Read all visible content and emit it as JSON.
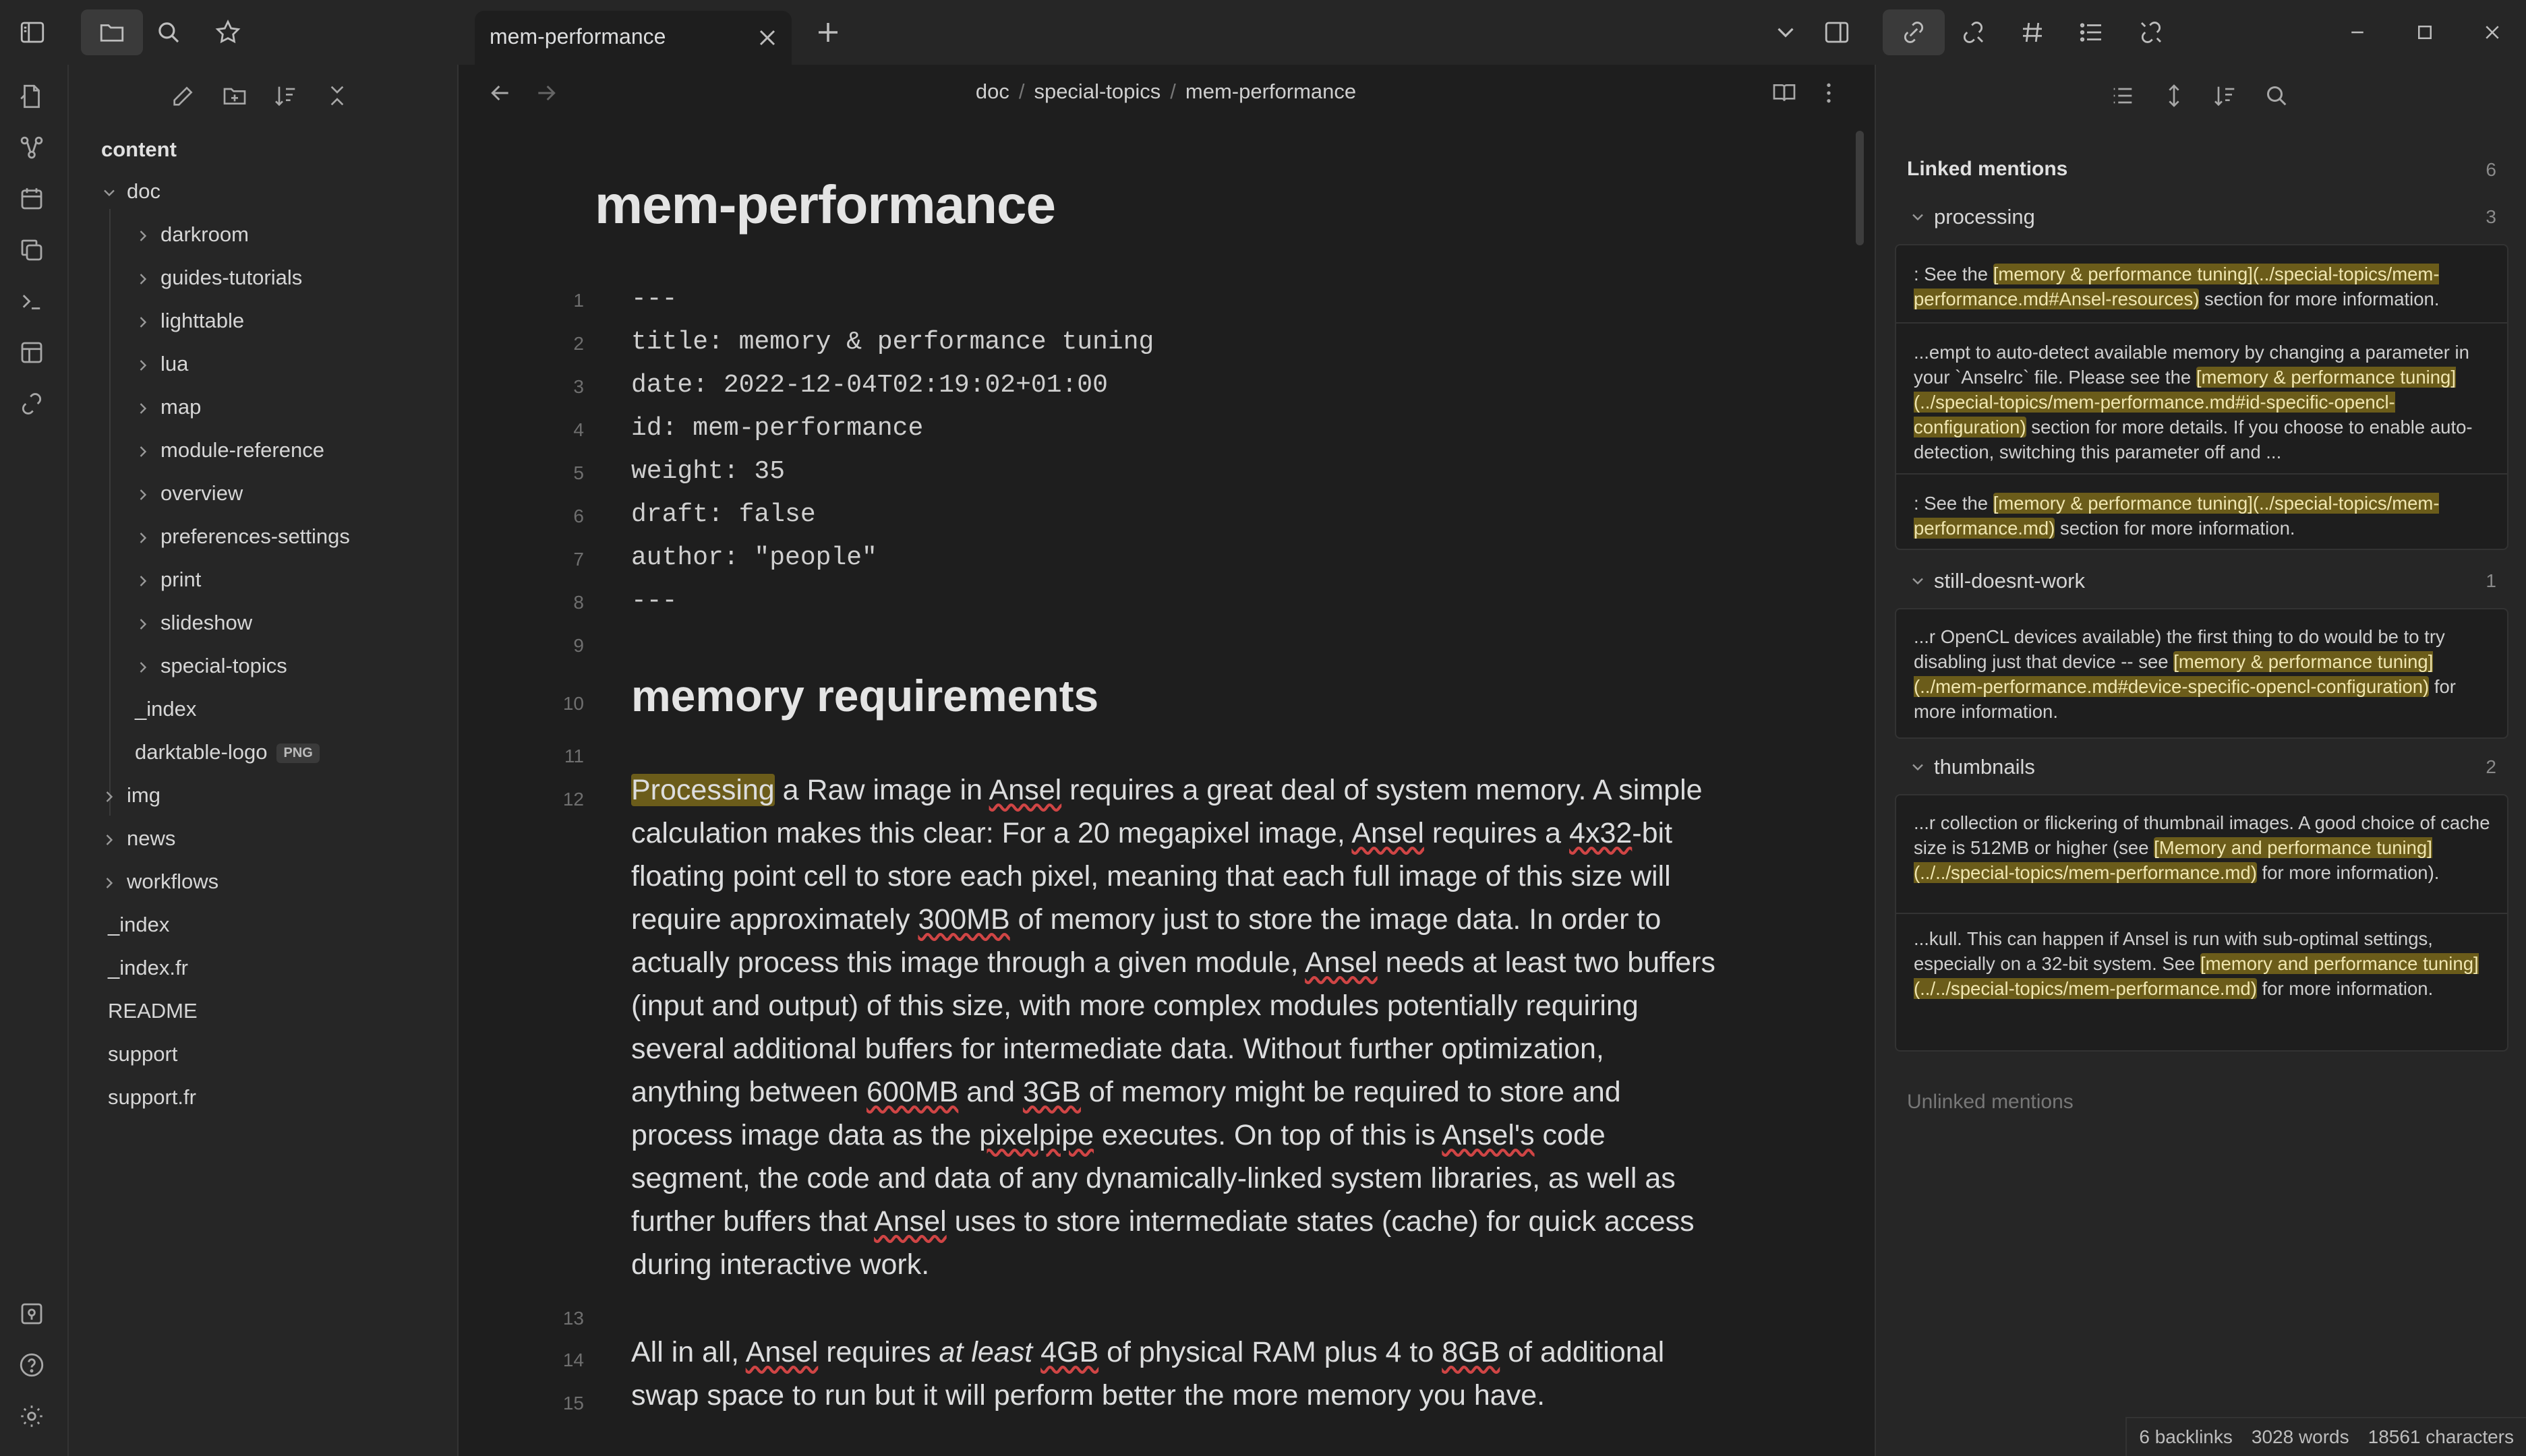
{
  "tab": {
    "title": "mem-performance"
  },
  "explorer": {
    "root": "content",
    "doc": "doc",
    "doc_children": [
      "darkroom",
      "guides-tutorials",
      "lighttable",
      "lua",
      "map",
      "module-reference",
      "overview",
      "preferences-settings",
      "print",
      "slideshow",
      "special-topics"
    ],
    "doc_files": [
      "_index",
      "darktable-logo"
    ],
    "logo_tag": "PNG",
    "root_folders": [
      "img",
      "news",
      "workflows"
    ],
    "root_files": [
      "_index",
      "_index.fr",
      "README",
      "support",
      "support.fr"
    ]
  },
  "breadcrumb": [
    "doc",
    "special-topics",
    "mem-performance"
  ],
  "breadcrumb_sep": "/",
  "editor": {
    "title": "mem-performance",
    "frontmatter": [
      "---",
      "title: memory & performance tuning",
      "date: 2022-12-04T02:19:02+01:00",
      "id: mem-performance",
      "weight: 35",
      "draft: false",
      "author: \"people\"",
      "---"
    ],
    "heading": "memory requirements",
    "line_numbers": [
      "1",
      "2",
      "3",
      "4",
      "5",
      "6",
      "7",
      "8",
      "9",
      "10",
      "11",
      "12",
      "13",
      "14",
      "15"
    ],
    "p1": [
      {
        "t": "Processing",
        "c": "hl"
      },
      {
        "t": " a Raw image in ",
        "c": ""
      },
      {
        "t": "Ansel",
        "c": "ul"
      },
      {
        "t": " requires a great deal of system memory. A simple calculation makes this clear: For a 20 megapixel image, ",
        "c": ""
      },
      {
        "t": "Ansel",
        "c": "ul"
      },
      {
        "t": " requires a ",
        "c": ""
      },
      {
        "t": "4x32",
        "c": "ul"
      },
      {
        "t": "-bit floating point cell to store each pixel, meaning that each full image of this size will require approximately ",
        "c": ""
      },
      {
        "t": "300MB",
        "c": "ul"
      },
      {
        "t": " of memory just to store the image data. In order to actually process this image through a given module, ",
        "c": ""
      },
      {
        "t": "Ansel",
        "c": "ul"
      },
      {
        "t": " needs at least two buffers (input and output) of this size, with more complex modules potentially requiring several additional buffers for intermediate data. Without further optimization, anything between ",
        "c": ""
      },
      {
        "t": "600MB",
        "c": "ul"
      },
      {
        "t": " and ",
        "c": ""
      },
      {
        "t": "3GB",
        "c": "ul"
      },
      {
        "t": " of memory might be required to store and process image data as the ",
        "c": ""
      },
      {
        "t": "pixelpipe",
        "c": "ul"
      },
      {
        "t": " executes. On top of this is ",
        "c": ""
      },
      {
        "t": "Ansel's",
        "c": "ul"
      },
      {
        "t": " code segment, the code and data of any dynamically-linked system libraries, as well as further buffers that ",
        "c": ""
      },
      {
        "t": "Ansel",
        "c": "ul"
      },
      {
        "t": " uses to store intermediate states (cache) for quick access during interactive work.",
        "c": ""
      }
    ],
    "p2": [
      {
        "t": "All in all, ",
        "c": ""
      },
      {
        "t": "Ansel",
        "c": "ul"
      },
      {
        "t": " requires ",
        "c": ""
      },
      {
        "t": "at least",
        "c": "em"
      },
      {
        "t": " ",
        "c": ""
      },
      {
        "t": "4GB",
        "c": "ul"
      },
      {
        "t": " of physical RAM plus 4 to ",
        "c": ""
      },
      {
        "t": "8GB",
        "c": "ul"
      },
      {
        "t": " of additional swap space to run but it will perform better the more memory you have.",
        "c": ""
      }
    ]
  },
  "backlinks": {
    "linked_title": "Linked mentions",
    "linked_count": "6",
    "groups": [
      {
        "name": "processing",
        "count": "3",
        "snippets": [
          [
            {
              "t": ": See the ",
              "c": ""
            },
            {
              "t": "[memory & performance tuning](../special-topics/mem-performance.md#Ansel-resources)",
              "c": "hl"
            },
            {
              "t": " section for more information.",
              "c": ""
            }
          ],
          [
            {
              "t": "...empt to auto-detect available memory by changing a parameter in your `Anselrc` file. Please see the ",
              "c": ""
            },
            {
              "t": "[memory & performance tuning](../special-topics/mem-performance.md#id-specific-opencl-configuration)",
              "c": "hl"
            },
            {
              "t": " section for more details. If you choose to enable auto-detection, switching this parameter off and ...",
              "c": ""
            }
          ],
          [
            {
              "t": ": See the ",
              "c": ""
            },
            {
              "t": "[memory & performance tuning](../special-topics/mem-performance.md)",
              "c": "hl"
            },
            {
              "t": " section for more information.",
              "c": ""
            }
          ]
        ]
      },
      {
        "name": "still-doesnt-work",
        "count": "1",
        "snippets": [
          [
            {
              "t": "...r OpenCL devices available) the first thing to do would be to try disabling just that device -- see ",
              "c": ""
            },
            {
              "t": "[memory & performance tuning](../mem-performance.md#device-specific-opencl-configuration)",
              "c": "hl"
            },
            {
              "t": " for more information.",
              "c": ""
            }
          ]
        ]
      },
      {
        "name": "thumbnails",
        "count": "2",
        "snippets": [
          [
            {
              "t": "...r collection or flickering of thumbnail images. A good choice of cache size is 512MB or higher (see ",
              "c": ""
            },
            {
              "t": "[Memory and performance tuning](../../special-topics/mem-performance.md)",
              "c": "hl"
            },
            {
              "t": " for more information).",
              "c": ""
            }
          ],
          [
            {
              "t": "...kull. This can happen if Ansel is run with sub-optimal settings, especially on a 32-bit system. See ",
              "c": ""
            },
            {
              "t": "[memory and performance tuning](../../special-topics/mem-performance.md)",
              "c": "hl"
            },
            {
              "t": " for more information.",
              "c": ""
            }
          ]
        ]
      }
    ],
    "unlinked_title": "Unlinked mentions"
  },
  "status": {
    "backlinks": "6 backlinks",
    "words": "3028 words",
    "chars": "18561 characters"
  },
  "colors": {
    "highlight": "#6b5c1a",
    "background": "#1e1e1e",
    "panel": "#262626"
  }
}
